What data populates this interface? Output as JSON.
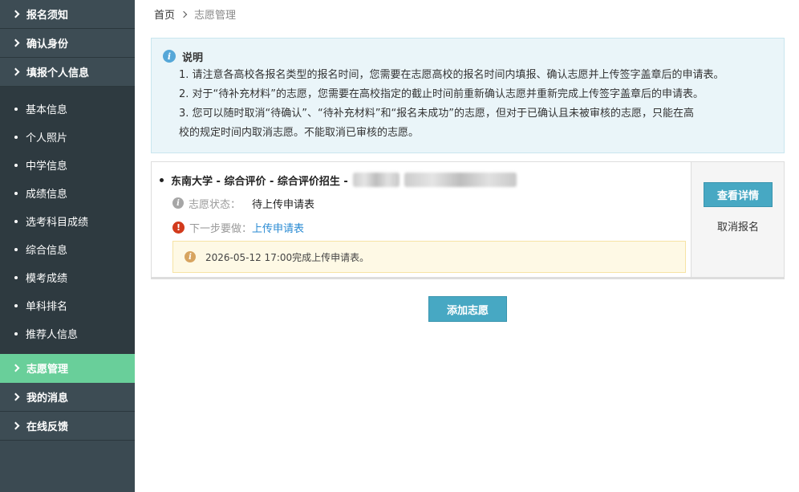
{
  "sidebar": {
    "top_items": [
      {
        "label": "报名须知"
      },
      {
        "label": "确认身份"
      },
      {
        "label": "填报个人信息"
      }
    ],
    "sub_items": [
      {
        "label": "基本信息"
      },
      {
        "label": "个人照片"
      },
      {
        "label": "中学信息"
      },
      {
        "label": "成绩信息"
      },
      {
        "label": "选考科目成绩"
      },
      {
        "label": "综合信息"
      },
      {
        "label": "模考成绩"
      },
      {
        "label": "单科排名"
      },
      {
        "label": "推荐人信息"
      }
    ],
    "bottom_items": [
      {
        "label": "志愿管理",
        "active": true
      },
      {
        "label": "我的消息"
      },
      {
        "label": "在线反馈"
      }
    ]
  },
  "breadcrumb": {
    "home": "首页",
    "current": "志愿管理"
  },
  "notice": {
    "title": "说明",
    "lines": [
      "1. 请注意各高校各报名类型的报名时间，您需要在志愿高校的报名时间内填报、确认志愿并上传签字盖章后的申请表。",
      "2. 对于“待补充材料”的志愿，您需要在高校指定的截止时间前重新确认志愿并重新完成上传签字盖章后的申请表。",
      "3. 您可以随时取消“待确认”、“待补充材料”和“报名未成功”的志愿，但对于已确认且未被审核的志愿，只能在高",
      "校的规定时间内取消志愿。不能取消已审核的志愿。"
    ]
  },
  "application": {
    "title": "东南大学 - 综合评价 - 综合评价招生 -",
    "status_label": "志愿状态：",
    "status_value": "待上传申请表",
    "next_label": "下一步要做：",
    "next_action": "上传申请表",
    "tip": "2026-05-12 17:00完成上传申请表。",
    "detail_button": "查看详情",
    "cancel_button": "取消报名"
  },
  "add_button": "添加志愿",
  "colors": {
    "sidebar_bg": "#3b4a52",
    "active_nav": "#69cf9a",
    "primary_button": "#47a8c3",
    "link": "#2a8bd3",
    "notice_bg": "#eaf5f9",
    "tip_bg": "#fef9e5"
  }
}
